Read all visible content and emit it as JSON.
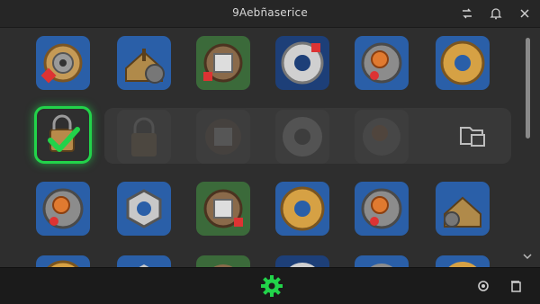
{
  "window": {
    "title": "9Aebñaserice"
  },
  "titlebar_icons": [
    "swap-icon",
    "bell-icon",
    "close-icon"
  ],
  "grid": {
    "rows": [
      [
        "gear-coin-icon",
        "broken-gear-house-icon",
        "gear-block-icon",
        "gear-silver-icon",
        "gear-orange-icon",
        "gear-gold-icon"
      ],
      [
        "lock-check-icon",
        "lock-icon",
        "gear-block-icon",
        "gear-silver-icon",
        "gear-orange-icon",
        "folder-copy-icon"
      ],
      [
        "gear-orange-icon",
        "nut-bolt-icon",
        "gear-block-icon",
        "gear-gold-icon",
        "gear-orange-icon",
        "broken-gear-house-icon"
      ],
      [
        "gear-gold-icon",
        "nut-bolt-icon",
        "gear-block-icon",
        "gear-silver-icon",
        "gear-orange-icon",
        "gear-gold-icon"
      ]
    ],
    "selected": {
      "row": 2,
      "col": 1
    }
  },
  "bottombar_icons": [
    "gear-active-icon",
    "settings-icon",
    "copy-icon"
  ],
  "colors": {
    "accent_green": "#22d34a",
    "tile_blue": "#2a5fa8",
    "tile_green": "#3f8f3a",
    "background": "#2e2e2e"
  }
}
